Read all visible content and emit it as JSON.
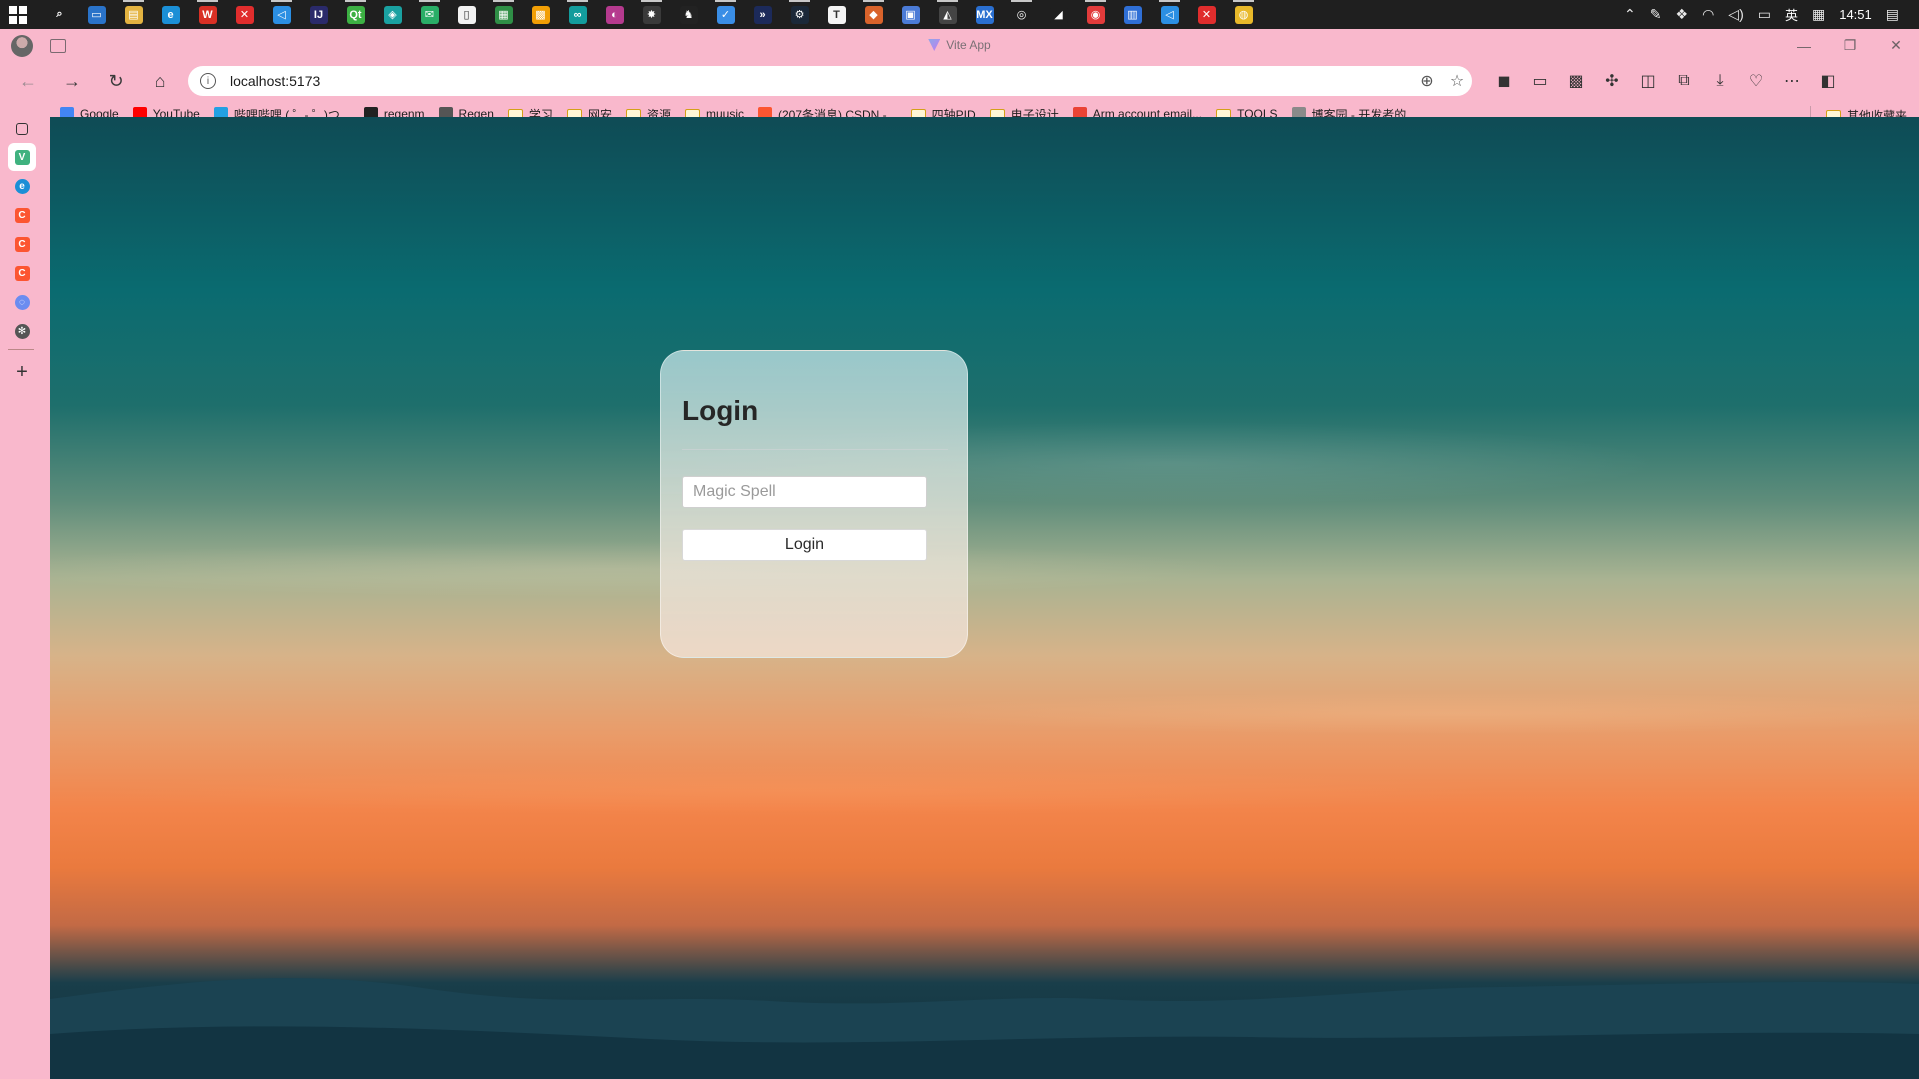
{
  "taskbar": {
    "apps": [
      {
        "icon": "search-icon",
        "color": "#1f1f1f",
        "glyph": "⌕"
      },
      {
        "icon": "desktop-icon",
        "color": "#2a73c9",
        "glyph": "▭"
      },
      {
        "icon": "file-explorer-icon",
        "color": "#e3b341",
        "glyph": "▤"
      },
      {
        "icon": "edge-icon",
        "color": "#1b8fd6",
        "glyph": "e"
      },
      {
        "icon": "wps-icon",
        "color": "#d93025",
        "glyph": "W"
      },
      {
        "icon": "xmind-icon",
        "color": "#e02d2d",
        "glyph": "✕"
      },
      {
        "icon": "vscode-icon",
        "color": "#2b8fe3",
        "glyph": "◁"
      },
      {
        "icon": "intellij-icon",
        "color": "#2a2a6a",
        "glyph": "IJ"
      },
      {
        "icon": "qt-icon",
        "color": "#3cb043",
        "glyph": "Qt"
      },
      {
        "icon": "app-orange-icon",
        "color": "#1aa1a1",
        "glyph": "◈"
      },
      {
        "icon": "wechat-icon",
        "color": "#2aae67",
        "glyph": "✉"
      },
      {
        "icon": "notepad-icon",
        "color": "#f2f2f2",
        "glyph": "▯"
      },
      {
        "icon": "excel-like-icon",
        "color": "#2f8f46",
        "glyph": "▦"
      },
      {
        "icon": "app-grid-icon",
        "color": "#f29f05",
        "glyph": "▩"
      },
      {
        "icon": "arduino-icon",
        "color": "#139c9c",
        "glyph": "∞"
      },
      {
        "icon": "app-purple-icon",
        "color": "#b53a8e",
        "glyph": "◐"
      },
      {
        "icon": "app-gray-icon",
        "color": "#3a3a3a",
        "glyph": "✸"
      },
      {
        "icon": "qq-icon",
        "color": "#222222",
        "glyph": "♞"
      },
      {
        "icon": "app-blue-icon",
        "color": "#3a8ee6",
        "glyph": "✓"
      },
      {
        "icon": "app-dark-icon",
        "color": "#1c2a5a",
        "glyph": "»"
      },
      {
        "icon": "steam-icon",
        "color": "#1b2838",
        "glyph": "⚙"
      },
      {
        "icon": "typora-icon",
        "color": "#f5f5f5",
        "glyph": "T"
      },
      {
        "icon": "fox-icon",
        "color": "#d9632b",
        "glyph": "◆"
      },
      {
        "icon": "remote-icon",
        "color": "#4b7bd6",
        "glyph": "▣"
      },
      {
        "icon": "app-bw-icon",
        "color": "#444444",
        "glyph": "◭"
      },
      {
        "icon": "mx-icon",
        "color": "#2a6fd0",
        "glyph": "MX"
      },
      {
        "icon": "app-circle-icon",
        "color": "#1f1f1f",
        "glyph": "◎"
      },
      {
        "icon": "app-orange2-icon",
        "color": "#1f1f1f",
        "glyph": "◢"
      },
      {
        "icon": "netease-music-icon",
        "color": "#e23b3b",
        "glyph": "◉"
      },
      {
        "icon": "app-window-icon",
        "color": "#2f6fd6",
        "glyph": "▥"
      },
      {
        "icon": "vscode2-icon",
        "color": "#2b8fe3",
        "glyph": "◁"
      },
      {
        "icon": "xmind2-icon",
        "color": "#e02d2d",
        "glyph": "✕"
      },
      {
        "icon": "shield-icon",
        "color": "#e8b92a",
        "glyph": "◍"
      }
    ],
    "ime": "英",
    "time": "14:51"
  },
  "browser": {
    "tab_title": "Vite App",
    "url": "localhost:5173",
    "bookmarks": [
      {
        "label": "Google",
        "icon": "google-icon",
        "color": "#4285f4",
        "type": "site"
      },
      {
        "label": "YouTube",
        "icon": "youtube-icon",
        "color": "#ff0000",
        "type": "site"
      },
      {
        "label": "哔哩哔哩 ( ゜- ゜)つ...",
        "icon": "bilibili-icon",
        "color": "#23a0e3",
        "type": "site"
      },
      {
        "label": "regenm",
        "icon": "github-icon",
        "color": "#222222",
        "type": "site"
      },
      {
        "label": "Regen",
        "icon": "regen-avatar-icon",
        "color": "#555555",
        "type": "site"
      },
      {
        "label": "学习",
        "icon": "folder-icon",
        "color": "#d4a017",
        "type": "folder"
      },
      {
        "label": "网安",
        "icon": "folder-icon",
        "color": "#d4a017",
        "type": "folder"
      },
      {
        "label": "资源",
        "icon": "folder-icon",
        "color": "#d4a017",
        "type": "folder"
      },
      {
        "label": "muusic",
        "icon": "folder-icon",
        "color": "#d4a017",
        "type": "folder"
      },
      {
        "label": "(207条消息) CSDN -...",
        "icon": "csdn-icon",
        "color": "#fc5531",
        "type": "site"
      },
      {
        "label": "四轴PID",
        "icon": "folder-icon",
        "color": "#d4a017",
        "type": "folder"
      },
      {
        "label": "电子设计",
        "icon": "folder-icon",
        "color": "#d4a017",
        "type": "folder"
      },
      {
        "label": "Arm account email...",
        "icon": "gmail-icon",
        "color": "#ea4335",
        "type": "site"
      },
      {
        "label": "TOOLS",
        "icon": "folder-icon",
        "color": "#d4a017",
        "type": "folder"
      },
      {
        "label": "博客园 - 开发者的...",
        "icon": "cnblogs-icon",
        "color": "#8a8a8a",
        "type": "site"
      }
    ],
    "other_bookmarks": "其他收藏夹",
    "sidebar": [
      {
        "icon": "vue-icon",
        "color": "#3fb27f",
        "glyph": "V",
        "active": true
      },
      {
        "icon": "edge-icon",
        "color": "#1b8fd6",
        "glyph": "e"
      },
      {
        "icon": "csdn-icon",
        "color": "#fc5531",
        "glyph": "C"
      },
      {
        "icon": "csdn-icon",
        "color": "#fc5531",
        "glyph": "C"
      },
      {
        "icon": "csdn-icon",
        "color": "#fc5531",
        "glyph": "C"
      },
      {
        "icon": "app-blue-icon",
        "color": "#6b8cf0",
        "glyph": "◌"
      },
      {
        "icon": "openai-icon",
        "color": "#555555",
        "glyph": "✻"
      }
    ]
  },
  "page": {
    "title": "Login",
    "input_placeholder": "Magic Spell",
    "button_label": "Login"
  }
}
